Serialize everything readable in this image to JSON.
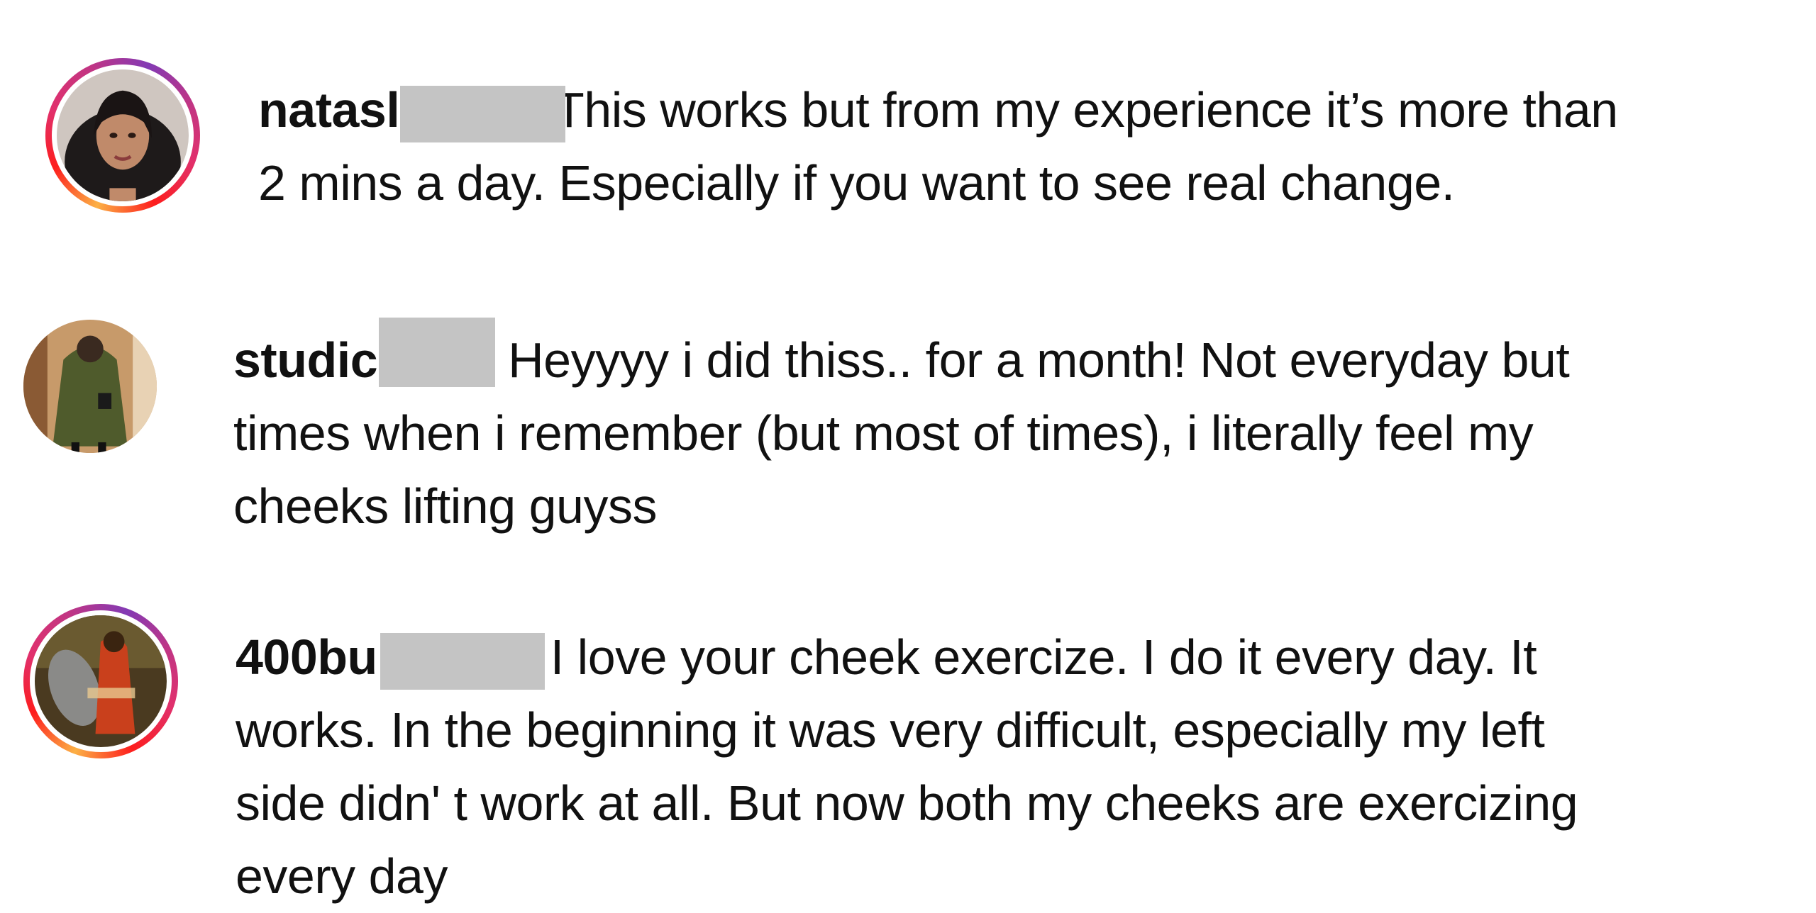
{
  "comments": [
    {
      "username": "natasl",
      "lines": [
        "This works but from my experience it’s more than",
        "2 mins a day. Especially if you want to see real change."
      ]
    },
    {
      "username": "studic",
      "lines": [
        "Heyyyy i did thiss.. for a month! Not everyday but",
        "times when i remember (but most of times), i literally feel my",
        "cheeks lifting guyss"
      ]
    },
    {
      "username": "400bu",
      "lines": [
        "I love your cheek exercize. I do it every day. It",
        "works. In the beginning it was very difficult, especially my left",
        "side didn' t work at all. But now both my cheeks are exercizing",
        "every day"
      ]
    }
  ],
  "colors": {
    "text": "#111111",
    "redaction": "#c4c4c4",
    "story_ring_start": "#fcb045",
    "story_ring_mid": "#e1306c",
    "story_ring_end": "#833ab4"
  }
}
